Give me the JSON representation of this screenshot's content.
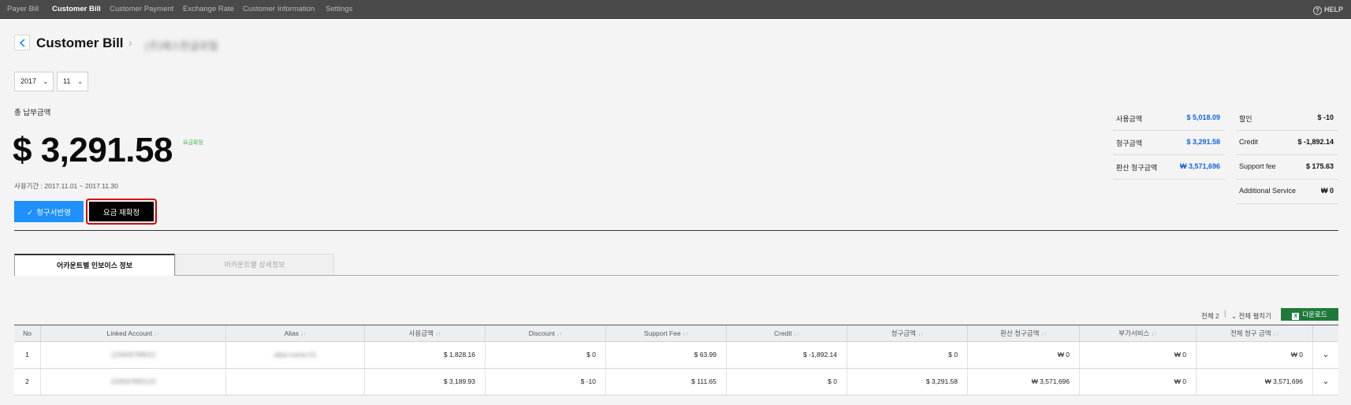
{
  "nav": {
    "items": [
      "Payer Bill",
      "Customer Bill",
      "Customer Payment",
      "Exchange Rate",
      "Customer Information",
      "Settings"
    ],
    "active": "Customer Bill",
    "help": "HELP"
  },
  "header": {
    "title": "Customer Bill",
    "separator": "›",
    "customer_name": "(주)예스한글로텔"
  },
  "filters": {
    "year": "2017",
    "month": "11"
  },
  "amount": {
    "label": "총 납부금액",
    "value": "$ 3,291.58",
    "status": "요금확정",
    "period": "사용기간 : 2017.11.01 ~ 2017.11.30"
  },
  "actions": {
    "apply": "청구서반영",
    "recalc": "요금 재확정"
  },
  "summary": {
    "left": [
      {
        "label": "사용금액",
        "value": "$ 5,018.09"
      },
      {
        "label": "청구금액",
        "value": "$ 3,291.58"
      },
      {
        "label": "환산 청구금액",
        "value": "₩ 3,571,696"
      }
    ],
    "right": [
      {
        "label": "할인",
        "value": "$ -10"
      },
      {
        "label": "Credit",
        "value": "$ -1,892.14"
      },
      {
        "label": "Support fee",
        "value": "$ 175.63"
      },
      {
        "label": "Additional Service",
        "value": "₩ 0"
      }
    ]
  },
  "tabs": [
    "어카운트별 인보이스 정보",
    "어카운트별 상세정보"
  ],
  "toolbar": {
    "total": "전체 2",
    "expand_all": "전체 펼치기",
    "download": "다운로드"
  },
  "table": {
    "headers": [
      "No",
      "Linked Account",
      "Alias",
      "사용금액",
      "Discount",
      "Support Fee",
      "Credit",
      "청구금액",
      "환산 청구금액",
      "부가서비스",
      "전체 청구 금액"
    ],
    "sort_glyph": "↓↑",
    "rows": [
      {
        "no": "1",
        "account": "123456789012",
        "alias": "alias-name-01",
        "usage": "$ 1,828.16",
        "discount": "$ 0",
        "support": "$ 63.99",
        "credit": "$ -1,892.14",
        "billed": "$ 0",
        "converted": "₩ 0",
        "addon": "₩ 0",
        "total": "₩ 0"
      },
      {
        "no": "2",
        "account": "234567890123",
        "alias": "",
        "usage": "$ 3,189.93",
        "discount": "$ -10",
        "support": "$ 111.65",
        "credit": "$ 0",
        "billed": "$ 3,291.58",
        "converted": "₩ 3,571,696",
        "addon": "₩ 0",
        "total": "₩ 3,571,696"
      }
    ]
  },
  "colors": {
    "accent_blue": "#1e90ff",
    "link_blue": "#1565e0",
    "highlight_red": "#d90000",
    "download_green": "#1f7a3a",
    "status_green": "#3ab54a"
  }
}
